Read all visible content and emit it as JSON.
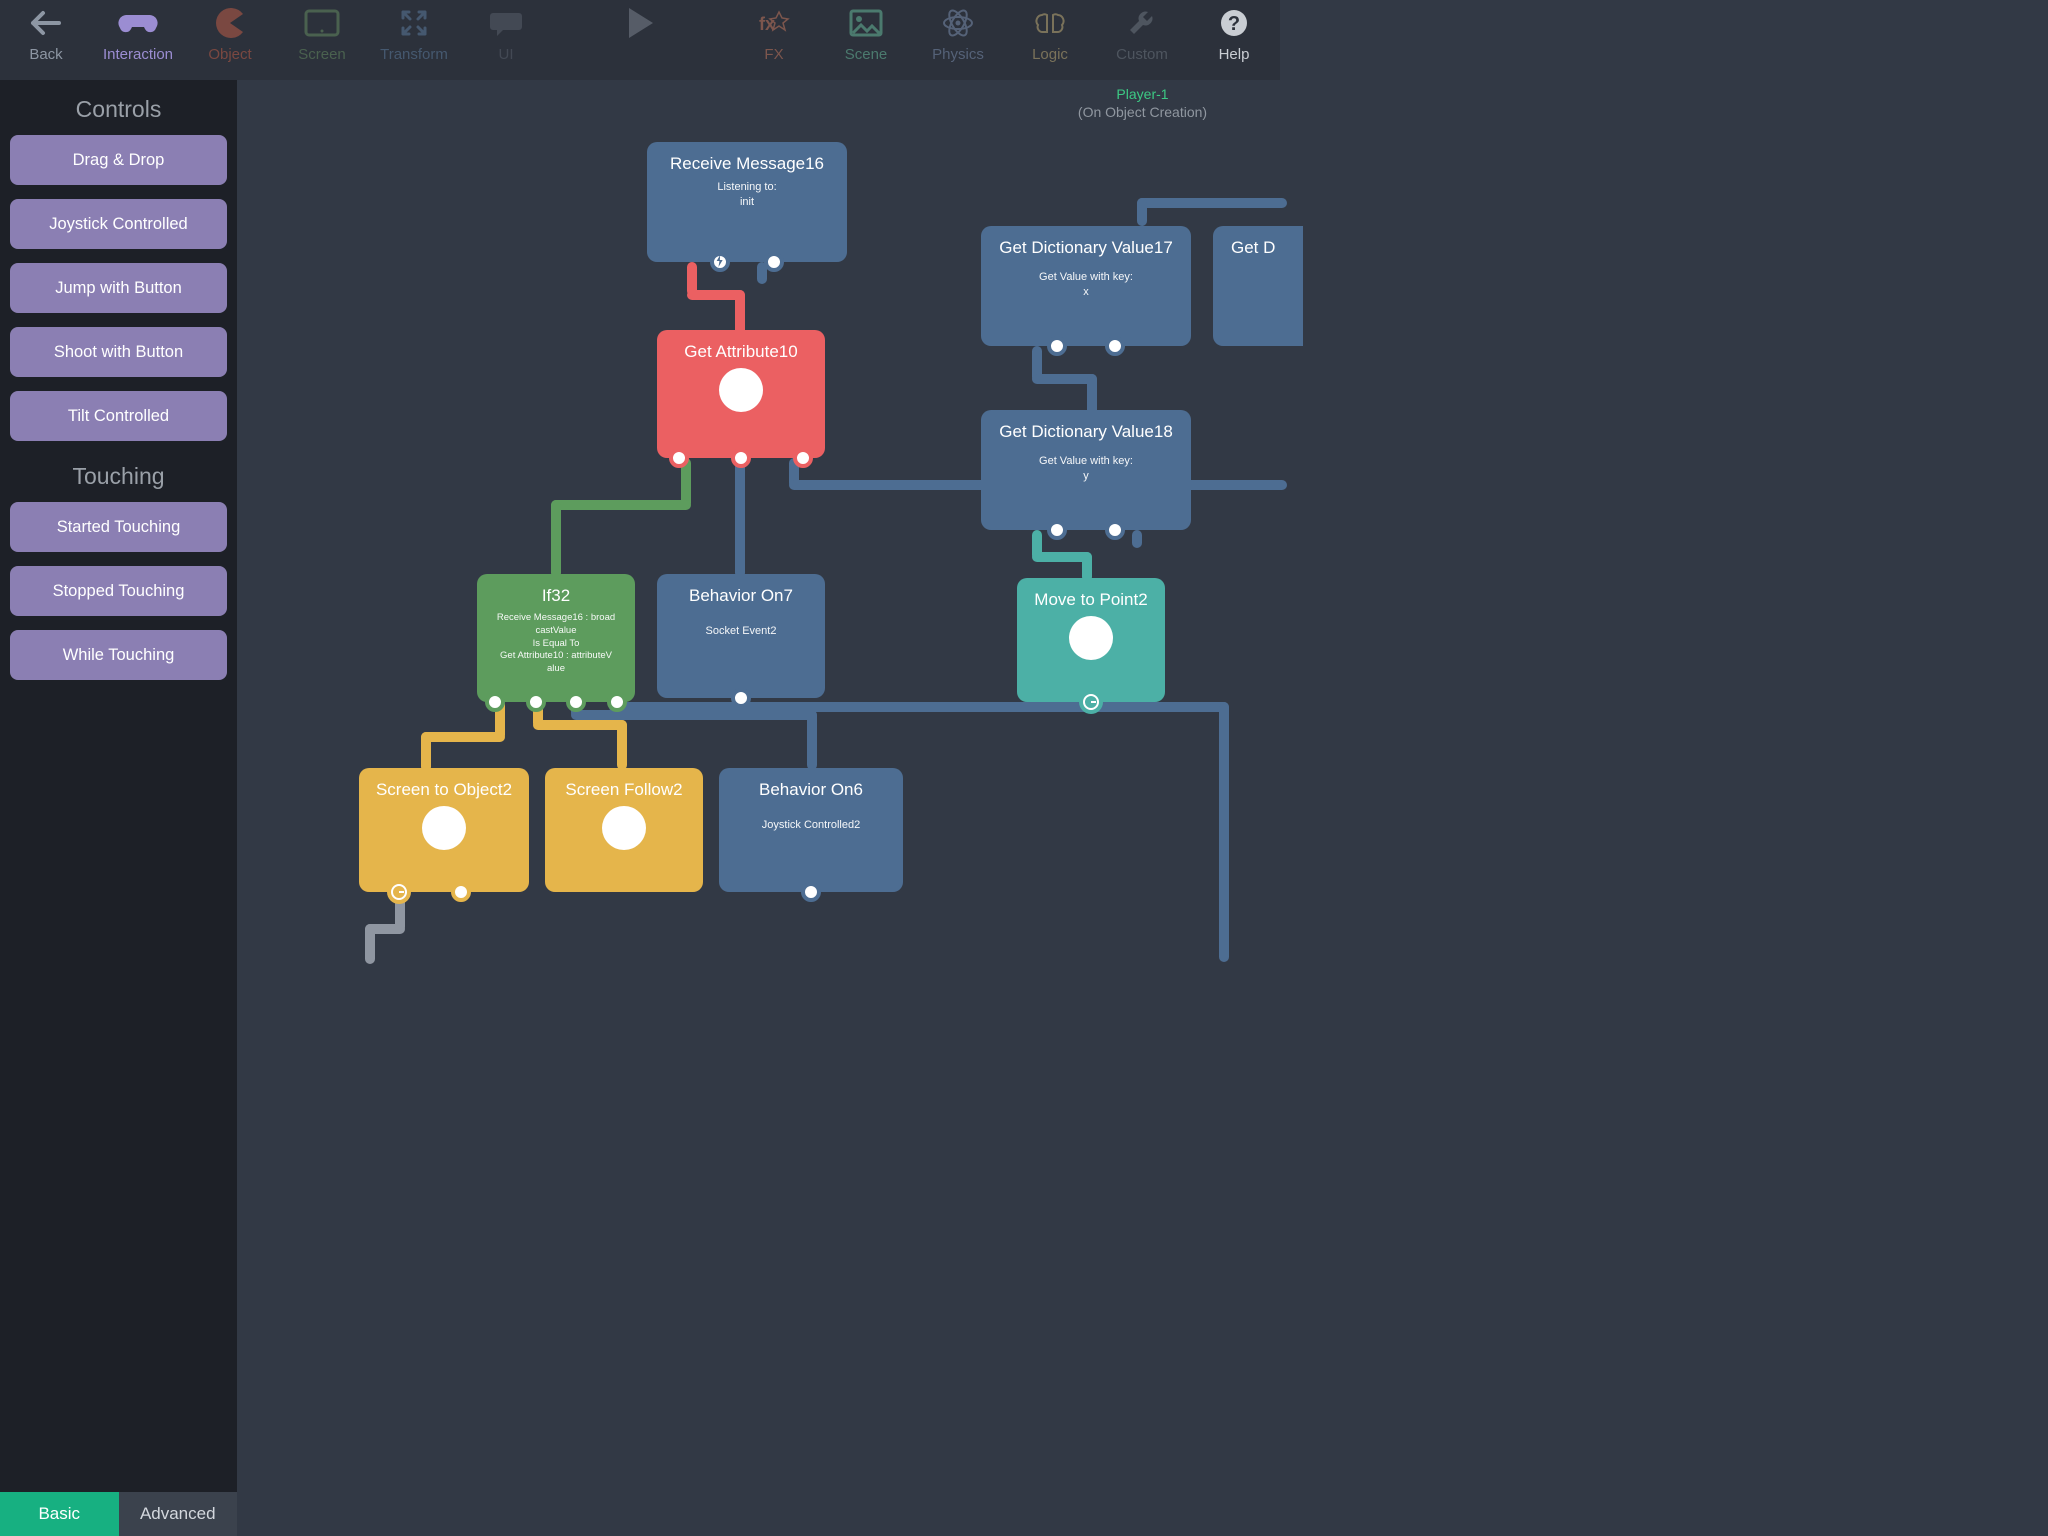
{
  "topbar": {
    "back": "Back",
    "interaction": "Interaction",
    "object": "Object",
    "screen": "Screen",
    "transform": "Transform",
    "ui": "UI",
    "fx": "FX",
    "scene": "Scene",
    "physics": "Physics",
    "logic": "Logic",
    "custom": "Custom",
    "help": "Help",
    "colors": {
      "back": "#8d96a3",
      "interaction": "#9b8dd2",
      "object": "#b2574e",
      "screen": "#4f7b58",
      "transform": "#4f6f93",
      "ui": "#4a4f59",
      "play": "#60656e",
      "fx": "#a0665a",
      "scene": "#57a08f",
      "physics": "#6a7a99",
      "logic": "#b1a07c",
      "custom": "#606773",
      "help": "#c9cdd3"
    }
  },
  "sidebar": {
    "sections": [
      {
        "title": "Controls",
        "items": [
          "Drag & Drop",
          "Joystick Controlled",
          "Jump with Button",
          "Shoot with Button",
          "Tilt Controlled"
        ]
      },
      {
        "title": "Touching",
        "items": [
          "Started Touching",
          "Stopped Touching",
          "While Touching"
        ]
      }
    ],
    "footer": {
      "basic": "Basic",
      "advanced": "Advanced"
    }
  },
  "canvas": {
    "title": "Player-1",
    "subtitle": "(On Object Creation)",
    "nodes": {
      "receive": {
        "title": "Receive Message16",
        "body_l1": "Listening to:",
        "body_l2": "init"
      },
      "getattr": {
        "title": "Get Attribute10"
      },
      "if32": {
        "title": "If32",
        "l1": "Receive Message16 : broad",
        "l2": "castValue",
        "l3": "Is Equal To",
        "l4": "Get Attribute10 : attributeV",
        "l5": "alue"
      },
      "bon7": {
        "title": "Behavior On7",
        "body": "Socket Event2"
      },
      "dict17": {
        "title": "Get Dictionary Value17",
        "body_l1": "Get Value with key:",
        "body_l2": "x"
      },
      "dict18": {
        "title": "Get Dictionary Value18",
        "body_l1": "Get Value with key:",
        "body_l2": "y"
      },
      "dict_cut": {
        "title": "Get D"
      },
      "move2": {
        "title": "Move to Point2"
      },
      "scr2obj": {
        "title": "Screen to Object2"
      },
      "scrfollow": {
        "title": "Screen Follow2"
      },
      "bon6": {
        "title": "Behavior On6",
        "body": "Joystick Controlled2"
      }
    }
  }
}
